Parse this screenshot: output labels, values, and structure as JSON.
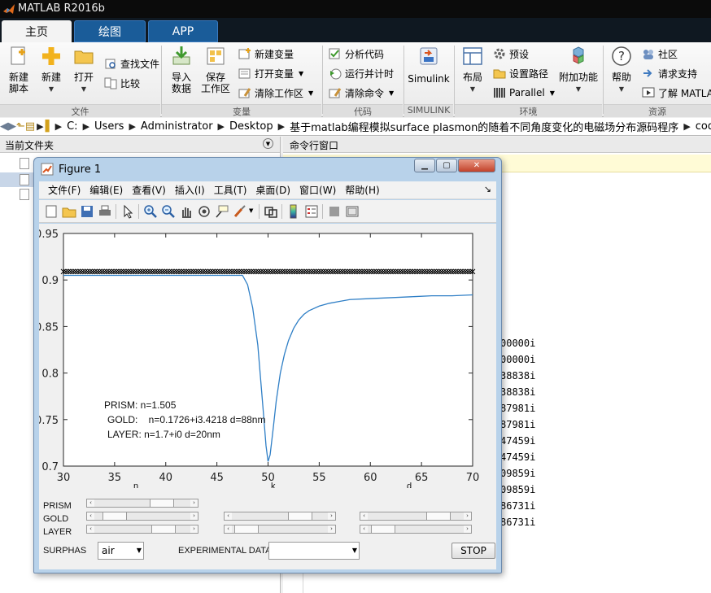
{
  "app": {
    "title": "MATLAB R2016b"
  },
  "tabs": [
    {
      "label": "主页",
      "active": true
    },
    {
      "label": "绘图",
      "active": false
    },
    {
      "label": "APP",
      "active": false
    }
  ],
  "ribbon": {
    "file": {
      "new_script": "新建\n脚本",
      "new": "新建",
      "open": "打开",
      "find_files": "查找文件",
      "compare": "比较",
      "group": "文件"
    },
    "variable": {
      "import_data": "导入\n数据",
      "save_workspace": "保存\n工作区",
      "new_variable": "新建变量",
      "open_variable": "打开变量",
      "clear_workspace": "清除工作区",
      "group": "变量"
    },
    "code": {
      "analyze_code": "分析代码",
      "run_and_time": "运行并计时",
      "clear_commands": "清除命令",
      "group": "代码"
    },
    "simulink": {
      "label": "Simulink",
      "group": "SIMULINK"
    },
    "environment": {
      "layout": "布局",
      "preferences": "预设",
      "set_path": "设置路径",
      "parallel": "Parallel",
      "addons": "附加功能",
      "group": "环境"
    },
    "resources": {
      "help": "帮助",
      "community": "社区",
      "request_support": "请求支持",
      "learn_matlab": "了解 MATLAB",
      "group": "资源"
    }
  },
  "address": {
    "crumbs": [
      "C:",
      "Users",
      "Administrator",
      "Desktop",
      "基于matlab编程模拟surface plasmon的随着不同角度变化的电磁场分布源码程序",
      "cod"
    ]
  },
  "panels": {
    "current_folder": "当前文件夹",
    "command_window": "命令行窗口",
    "command_output": [
      "00000i",
      "00000i",
      "38838i",
      "38838i",
      "87981i",
      "87981i",
      "47459i",
      "47459i",
      "09859i",
      "09859i",
      "86731i",
      "86731i"
    ]
  },
  "figure": {
    "title": "Figure 1",
    "menu": [
      "文件(F)",
      "编辑(E)",
      "查看(V)",
      "插入(I)",
      "工具(T)",
      "桌面(D)",
      "窗口(W)",
      "帮助(H)"
    ],
    "toolbar_icons": [
      "new-figure-icon",
      "open-icon",
      "save-icon",
      "print-icon",
      "arrow-cursor-icon",
      "zoom-in-icon",
      "zoom-out-icon",
      "pan-hand-icon",
      "rotate-icon",
      "data-cursor-icon",
      "brush-icon",
      "link-plot-icon",
      "colorbar-icon",
      "legend-icon",
      "hide-plot-tools-icon",
      "show-plot-tools-icon"
    ],
    "annotations": [
      "PRISM: n=1.505",
      "GOLD:    n=0.1726+i3.4218 d=88nm",
      "LAYER: n=1.7+i0 d=20nm"
    ],
    "slider_labels": [
      "PRISM",
      "GOLD",
      "LAYER"
    ],
    "column_labels": [
      "n",
      "k",
      "d"
    ],
    "surphas_label": "SURPHAS",
    "surphas_value": "air",
    "experimental_label": "EXPERIMENTAL DATA",
    "experimental_value": "",
    "stop_label": "STOP",
    "sliders": [
      {
        "row": 0,
        "col": 0,
        "value": 0.77
      },
      {
        "row": 1,
        "col": 0,
        "value": 0.11
      },
      {
        "row": 1,
        "col": 1,
        "value": 0.78
      },
      {
        "row": 1,
        "col": 2,
        "value": 0.82
      },
      {
        "row": 2,
        "col": 0,
        "value": 0.79
      },
      {
        "row": 2,
        "col": 1,
        "value": 0.03
      },
      {
        "row": 2,
        "col": 2,
        "value": 0.05
      }
    ]
  },
  "chart_data": {
    "type": "line",
    "xlim": [
      30,
      70
    ],
    "ylim": [
      0.7,
      0.95
    ],
    "xticks": [
      30,
      35,
      40,
      45,
      50,
      55,
      60,
      65,
      70
    ],
    "yticks": [
      0.7,
      0.75,
      0.8,
      0.85,
      0.9,
      0.95
    ],
    "grid": false,
    "series": [
      {
        "style": "line",
        "color": "#2f7fc6",
        "x": [
          47.5,
          48.0,
          48.5,
          49.0,
          49.3,
          49.6,
          49.8,
          50.0,
          50.2,
          50.5,
          50.8,
          51.2,
          51.6,
          52.0,
          52.5,
          53.0,
          53.5,
          54.0,
          55.0,
          56.0,
          57.0,
          58.0,
          60.0,
          62.0,
          64.0,
          66.0,
          68.0,
          70.0
        ],
        "y": [
          0.905,
          0.895,
          0.87,
          0.83,
          0.79,
          0.75,
          0.722,
          0.705,
          0.712,
          0.74,
          0.77,
          0.8,
          0.82,
          0.835,
          0.848,
          0.857,
          0.863,
          0.867,
          0.872,
          0.875,
          0.877,
          0.879,
          0.88,
          0.881,
          0.882,
          0.883,
          0.883,
          0.884
        ]
      },
      {
        "style": "markers-x",
        "color": "#000000",
        "x_range": [
          30,
          70
        ],
        "y": 0.909
      }
    ]
  }
}
